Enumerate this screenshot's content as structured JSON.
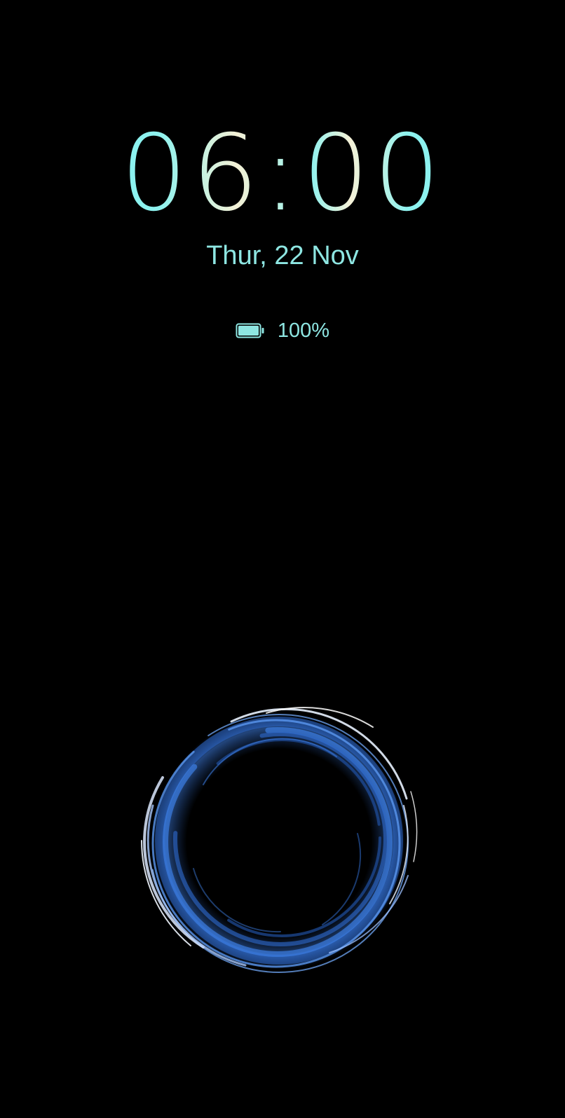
{
  "lockscreen": {
    "time": "06:00",
    "date": "Thur, 22 Nov",
    "battery": {
      "label": "100%",
      "level": 1.0,
      "icon": "battery-full-icon"
    },
    "wallpaper": {
      "icon": "swirl-ring-graphic"
    }
  },
  "colors": {
    "background": "#000000",
    "accent_text": "#8ee6e2",
    "clock_cyan": "#7ff0f2",
    "clock_cream": "#f4f1d6",
    "ring_blue": "#4f8de8",
    "ring_highlight": "#e6f0ff"
  }
}
